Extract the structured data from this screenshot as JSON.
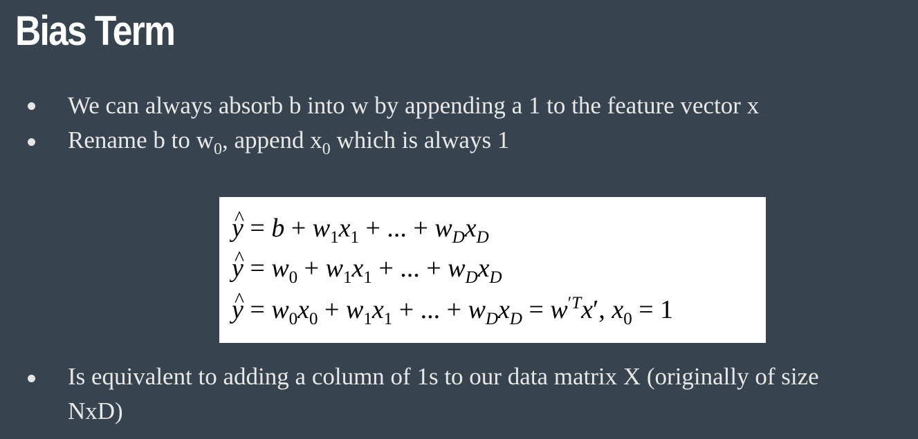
{
  "slide": {
    "title": "Bias Term"
  },
  "bullets": {
    "b1": "We can always absorb b into w by appending a 1 to the feature vector x",
    "b2": {
      "t1": "Rename b to w",
      "s1": "0",
      "t2": ", append x",
      "s2": "0",
      "t3": " which is always 1"
    },
    "b3": {
      "line1": "Is equivalent to adding a column of 1s to our data matrix X (originally of size",
      "line2": "NxD)"
    }
  },
  "equations": {
    "eq1": "ŷ = b + w₁x₁ + ... + w_D x_D",
    "eq2": "ŷ = w₀ + w₁x₁ + ... + w_D x_D",
    "eq3": "ŷ = w₀x₀ + w₁x₁ + ... + w_D x_D = w′ᵀx′, x₀ = 1"
  }
}
